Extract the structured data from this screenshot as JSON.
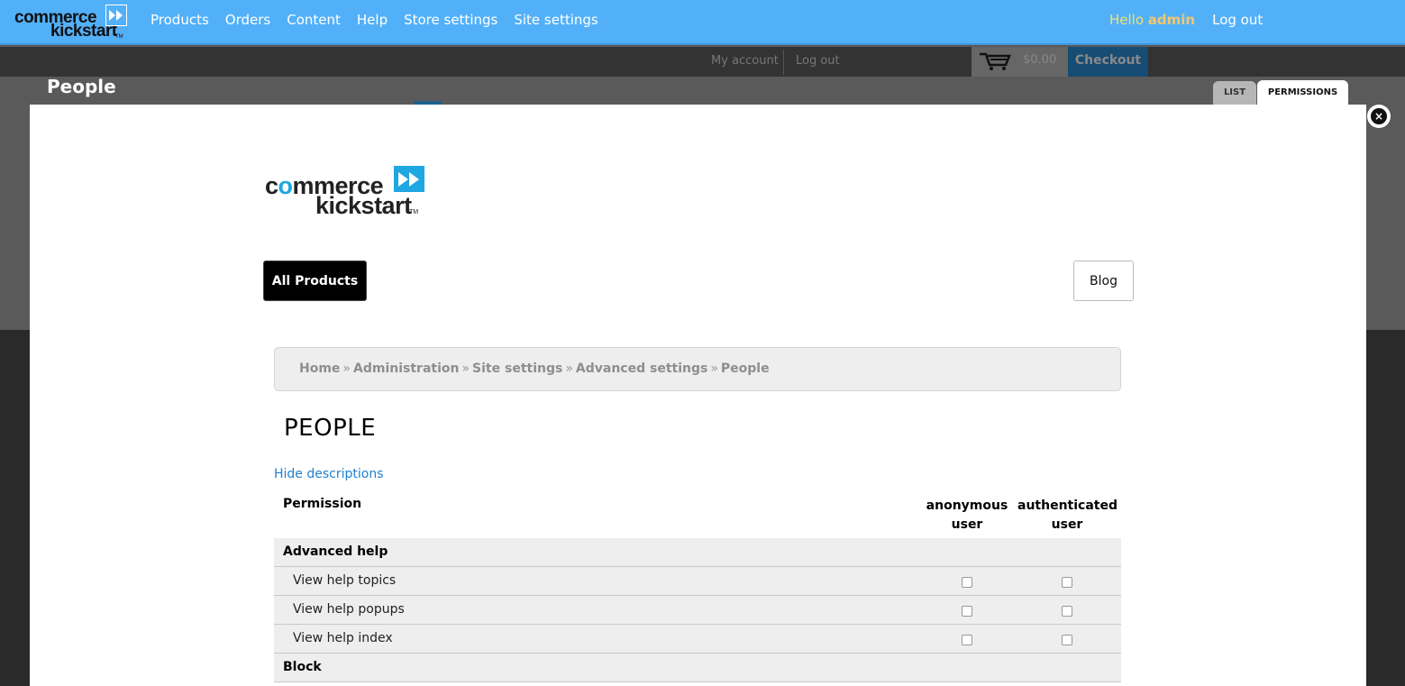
{
  "admin_bar": {
    "logo_line1": "commerce",
    "logo_line2": "kickstart",
    "logo_tm": "TM",
    "nav": [
      "Products",
      "Orders",
      "Content",
      "Help",
      "Store settings",
      "Site settings"
    ],
    "hello_prefix": "Hello ",
    "hello_user": "admin",
    "logout": "Log out",
    "bar_color": "#52b0f9"
  },
  "site": {
    "my_account": "My account",
    "log_out": "Log out",
    "cart_total": "$0.00",
    "checkout": "Checkout",
    "page_title": "People",
    "tabs": [
      "LIST",
      "PERMISSIONS"
    ]
  },
  "overlay": {
    "close_symbol": "×",
    "logo_line1_a": "c",
    "logo_line1_o": "o",
    "logo_line1_b": "mmerce",
    "logo_line2": "kickstart",
    "logo_tm": "TM",
    "accent_color": "#1ea7e1",
    "menu_all_products": "All Products",
    "menu_blog": "Blog",
    "breadcrumb": [
      "Home",
      "Administration",
      "Site settings",
      "Advanced settings",
      "People"
    ],
    "breadcrumb_sep": "»",
    "heading": "PEOPLE",
    "hide_descriptions": "Hide descriptions",
    "table": {
      "col_permission": "Permission",
      "col_anon_1": "anonymous",
      "col_anon_2": "user",
      "col_auth_1": "authenticated",
      "col_auth_2": "user",
      "rows": [
        {
          "type": "group",
          "label": "Advanced help"
        },
        {
          "type": "item",
          "label": "View help topics",
          "anon": false,
          "auth": false
        },
        {
          "type": "item",
          "label": "View help popups",
          "anon": false,
          "auth": false
        },
        {
          "type": "item",
          "label": "View help index",
          "anon": false,
          "auth": false
        },
        {
          "type": "group",
          "label": "Block"
        }
      ]
    }
  }
}
